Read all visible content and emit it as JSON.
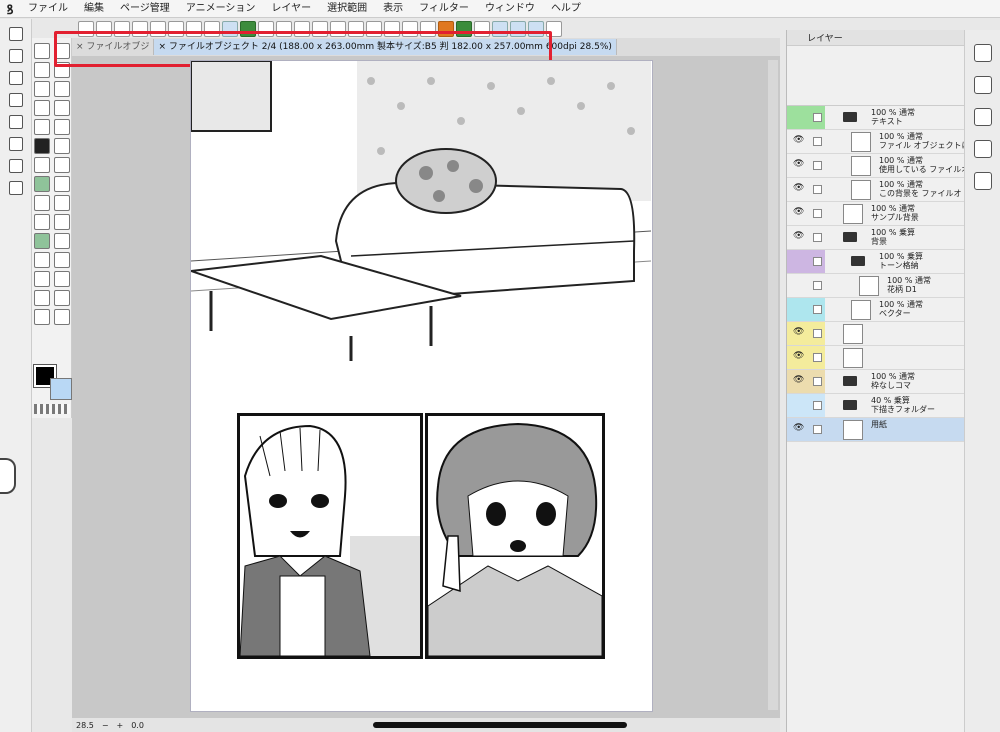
{
  "menu": [
    "ファイル",
    "編集",
    "ページ管理",
    "アニメーション",
    "レイヤー",
    "選択範囲",
    "表示",
    "フィルター",
    "ウィンドウ",
    "ヘルプ"
  ],
  "tabs": [
    {
      "label": "ファイルオブジ",
      "close": "×"
    },
    {
      "label": "ファイルオブジェクト 2/4 (188.00 x 263.00mm 製本サイズ:B5 判 182.00 x 257.00mm 600dpi 28.5%)",
      "close": "×"
    }
  ],
  "layer_panel": {
    "title": "レイヤー",
    "layers": [
      {
        "mode": "100 %  通常",
        "name": "テキスト",
        "type": "folder",
        "color": "green",
        "eye": "",
        "indent": 0
      },
      {
        "mode": "100 %  通常",
        "name": "ファイル オブジェクトに",
        "type": "layer",
        "eye": "👁",
        "indent": 1
      },
      {
        "mode": "100 %  通常",
        "name": "使用している ファイルオ",
        "type": "layer",
        "eye": "👁",
        "indent": 1
      },
      {
        "mode": "100 %  通常",
        "name": "この背景を ファイルオ",
        "type": "layer",
        "eye": "👁",
        "indent": 1
      },
      {
        "mode": "100 %  通常",
        "name": "サンプル背景",
        "type": "layer",
        "eye": "👁",
        "indent": 0
      },
      {
        "mode": "100 %  乗算",
        "name": "背景",
        "type": "folder",
        "eye": "👁",
        "indent": 0
      },
      {
        "mode": "100 %  乗算",
        "name": "トーン格納",
        "type": "folder",
        "color": "purple",
        "eye": "",
        "indent": 1
      },
      {
        "mode": "100 %  通常",
        "name": "花柄 D1",
        "type": "layer",
        "eye": "",
        "indent": 2
      },
      {
        "mode": "100 %  通常",
        "name": "ベクター",
        "type": "layer",
        "color": "cyan",
        "eye": "",
        "indent": 1
      },
      {
        "mode": "",
        "name": "",
        "type": "layer",
        "color": "yellow",
        "eye": "👁",
        "indent": 0
      },
      {
        "mode": "",
        "name": "",
        "type": "layer",
        "color": "yellow",
        "eye": "👁",
        "indent": 0
      },
      {
        "mode": "100 %  通常",
        "name": "枠なしコマ",
        "type": "folder",
        "color": "tan",
        "eye": "👁",
        "indent": 0
      },
      {
        "mode": "40 %  乗算",
        "name": "下描きフォルダー",
        "type": "folder",
        "color": "lightblue",
        "eye": "",
        "indent": 0
      },
      {
        "mode": "",
        "name": "用紙",
        "type": "layer",
        "eye": "👁",
        "indent": 0,
        "selected": true
      }
    ]
  },
  "status": {
    "zoom": "28.5",
    "angle": "0.0",
    "minus": "−",
    "plus": "+"
  }
}
